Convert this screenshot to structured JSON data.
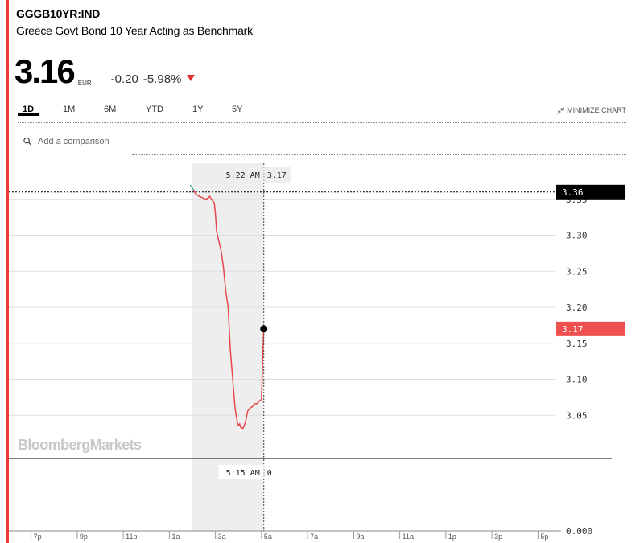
{
  "header": {
    "ticker": "GGGB10YR:IND",
    "name": "Greece Govt Bond 10 Year Acting as Benchmark"
  },
  "quote": {
    "price": "3.16",
    "currency": "EUR",
    "change": "-0.20",
    "change_pct": "-5.98%",
    "direction_icon": "down-triangle-icon",
    "down_color": "#e03131"
  },
  "range_tabs": {
    "items": [
      "1D",
      "1M",
      "6M",
      "YTD",
      "1Y",
      "5Y"
    ],
    "active": "1D",
    "minimize_label": "MINIMIZE CHART",
    "minimize_icon": "collapse-arrows-icon"
  },
  "compare": {
    "placeholder": "Add a comparison",
    "icon": "search-icon"
  },
  "watermark": "BloombergMarkets",
  "crosshair": {
    "time": "5:22 AM",
    "value": "3.17",
    "volume_time": "5:15 AM",
    "volume_value": "0"
  },
  "chart_data": {
    "type": "line",
    "y_ticks": [
      "3.35",
      "3.30",
      "3.25",
      "3.20",
      "3.15",
      "3.10",
      "3.05"
    ],
    "y_tick_values": [
      3.35,
      3.3,
      3.25,
      3.2,
      3.15,
      3.1,
      3.05
    ],
    "ylim": [
      3.0,
      3.4
    ],
    "prev_close_label": "3.36",
    "prev_close_value": 3.36,
    "last_label": "3.17",
    "last_value": 3.17,
    "x_ticks": [
      "7p",
      "9p",
      "11p",
      "1a",
      "3a",
      "5a",
      "7a",
      "9a",
      "11a",
      "1p",
      "3p",
      "5p"
    ],
    "x_tick_hours": [
      19,
      21,
      23,
      25,
      27,
      29,
      31,
      33,
      35,
      37,
      39,
      41
    ],
    "xlim_hours": [
      18.0,
      42.0
    ],
    "series": [
      {
        "color": "#e8484c",
        "x_hours": [
          26.05,
          26.15,
          26.3,
          26.45,
          26.55,
          26.65,
          26.75,
          26.85,
          26.95,
          27.0,
          27.05,
          27.15,
          27.25,
          27.35,
          27.45,
          27.55,
          27.65,
          27.75,
          27.85,
          27.95,
          28.0,
          28.05,
          28.1,
          28.2,
          28.3,
          28.4,
          28.5,
          28.6,
          28.7,
          28.8,
          28.9,
          29.0,
          29.05,
          29.1
        ],
        "values": [
          3.363,
          3.357,
          3.354,
          3.352,
          3.35,
          3.351,
          3.354,
          3.349,
          3.345,
          3.33,
          3.305,
          3.292,
          3.278,
          3.255,
          3.222,
          3.2,
          3.14,
          3.1,
          3.06,
          3.04,
          3.036,
          3.038,
          3.033,
          3.032,
          3.04,
          3.056,
          3.06,
          3.062,
          3.066,
          3.066,
          3.07,
          3.072,
          3.13,
          3.17
        ]
      }
    ],
    "volume": {
      "ylabel": "0.000",
      "value_at_cursor": 0
    },
    "session_start_hour": 26.0,
    "cursor_hour": 29.1
  }
}
